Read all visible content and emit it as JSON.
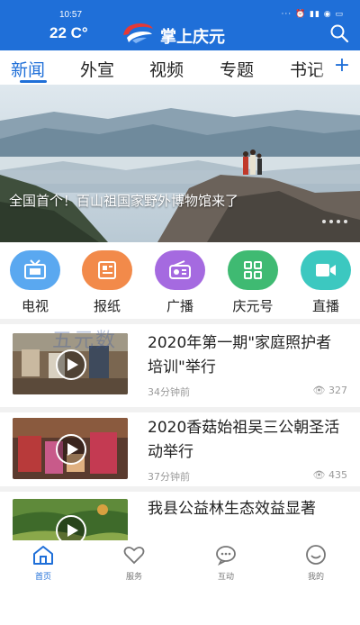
{
  "status": {
    "time": "10:57",
    "icons": "··· ⏰ ▮▮ ◉ ▭"
  },
  "header": {
    "temperature": "22 C°",
    "app_title": "掌上庆元"
  },
  "tabs": [
    {
      "label": "新闻",
      "active": true
    },
    {
      "label": "外宣"
    },
    {
      "label": "视频"
    },
    {
      "label": "专题"
    },
    {
      "label": "书记"
    }
  ],
  "tabs_plus": "+",
  "banner": {
    "caption": "全国首个！百山祖国家野外博物馆来了"
  },
  "quicknav": [
    {
      "label": "电视",
      "icon": "tv-icon",
      "color": "#5aa8f0"
    },
    {
      "label": "报纸",
      "icon": "newspaper-icon",
      "color": "#f28a4a"
    },
    {
      "label": "广播",
      "icon": "radio-icon",
      "color": "#a56ae0"
    },
    {
      "label": "庆元号",
      "icon": "grid-icon",
      "color": "#3fba72"
    },
    {
      "label": "直播",
      "icon": "video-camera-icon",
      "color": "#3cc8c0"
    }
  ],
  "watermark": "五元数",
  "news": [
    {
      "title": "2020年第一期\"家庭照护者培训\"举行",
      "time": "34分钟前",
      "views": "327"
    },
    {
      "title": "2020香菇始祖吴三公朝圣活动举行",
      "time": "37分钟前",
      "views": "435"
    },
    {
      "title": "我县公益林生态效益显著",
      "time": "",
      "views": ""
    }
  ],
  "bottom_nav": [
    {
      "label": "首页",
      "icon": "home-icon",
      "active": true
    },
    {
      "label": "服务",
      "icon": "heart-icon"
    },
    {
      "label": "互动",
      "icon": "chat-icon"
    },
    {
      "label": "我的",
      "icon": "smile-icon"
    }
  ],
  "colors": {
    "brand": "#1f6fd8",
    "divider": "#f1f1f1"
  }
}
